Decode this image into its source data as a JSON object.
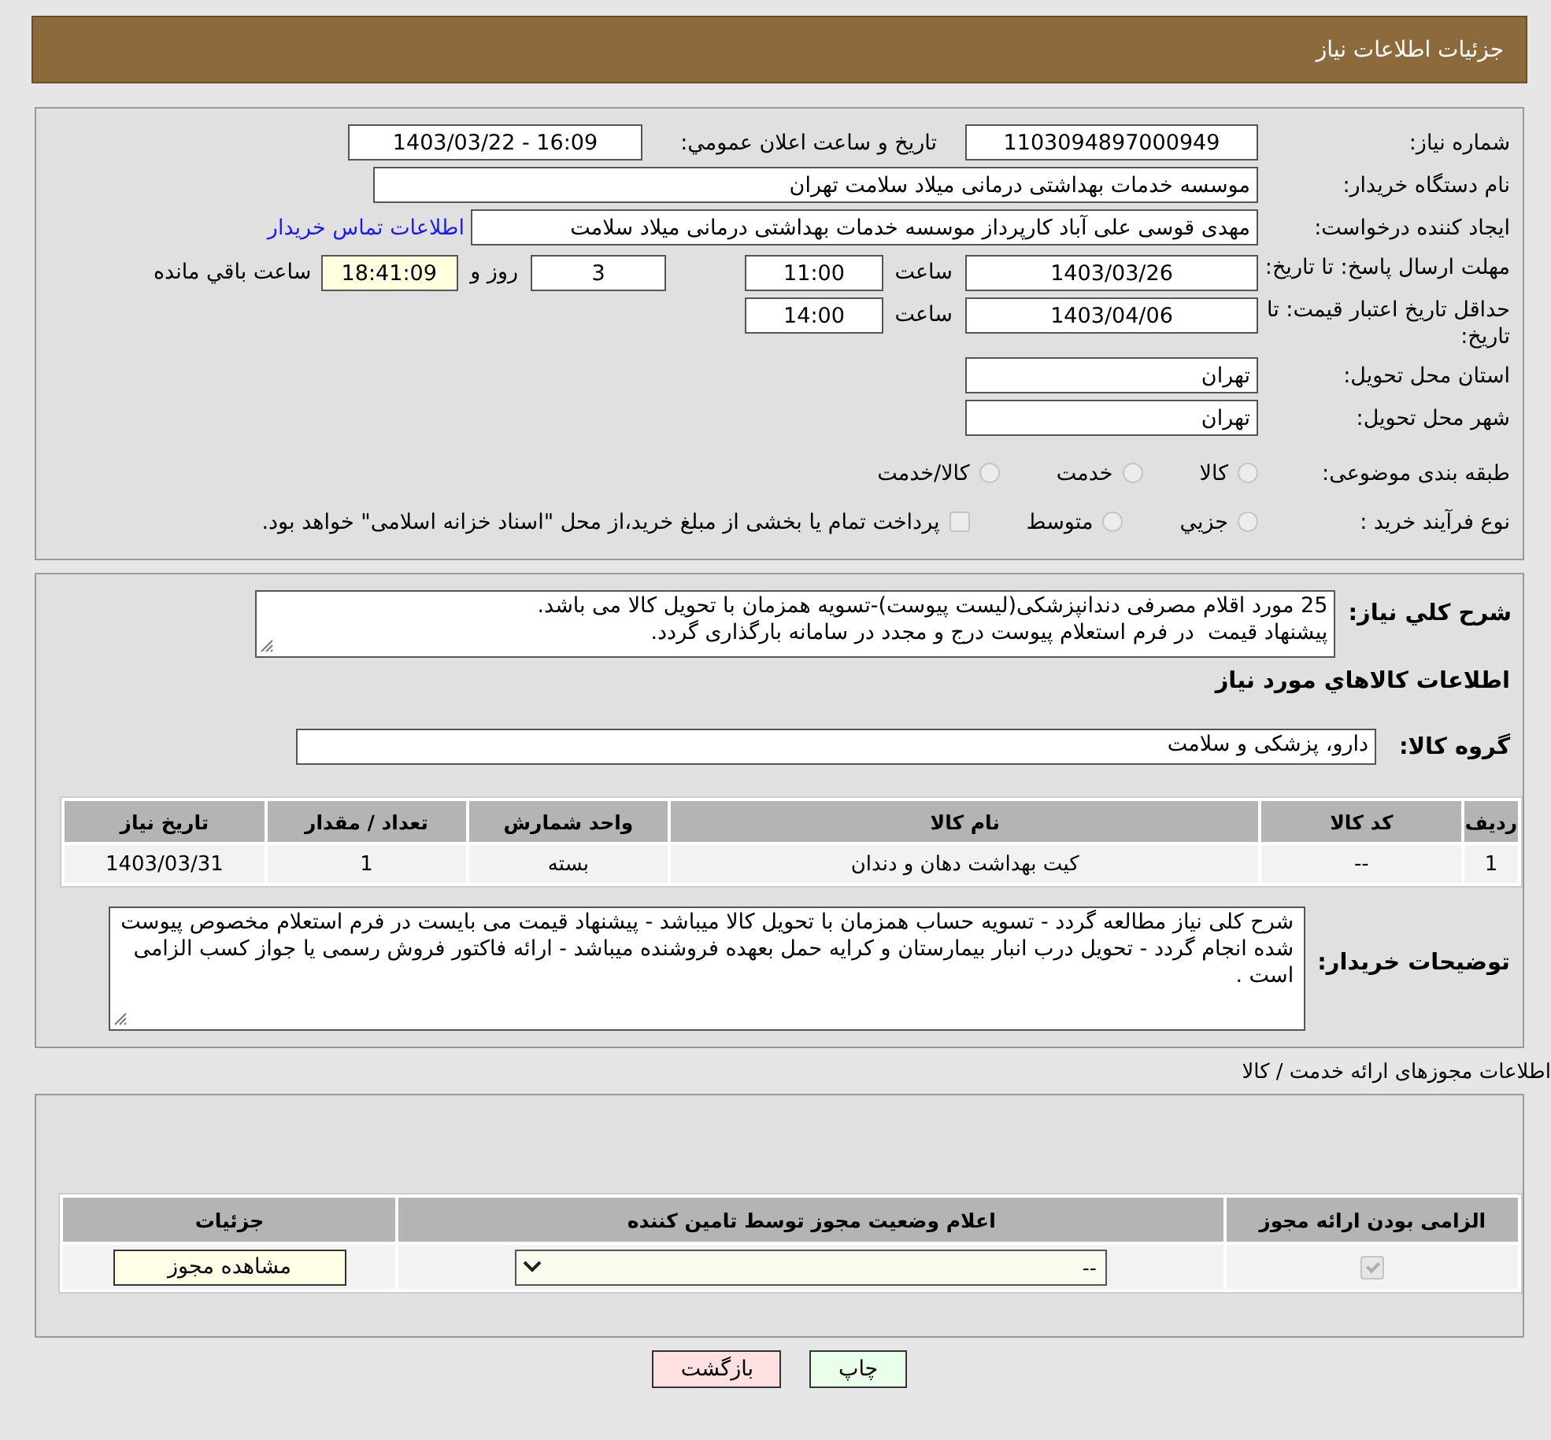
{
  "header": {
    "title": "جزئیات اطلاعات نیاز"
  },
  "info": {
    "need_number": {
      "label": "شماره نیاز:",
      "value": "1103094897000949"
    },
    "announce": {
      "label": "تاریخ و ساعت اعلان عمومي:",
      "value": "1403/03/22 - 16:09"
    },
    "buyer": {
      "label": "نام دستگاه خریدار:",
      "value": "موسسه خدمات بهداشتی درمانی میلاد سلامت تهران"
    },
    "requester": {
      "label": "ایجاد کننده درخواست:",
      "value": "مهدی قوسی علی آباد کارپرداز موسسه خدمات بهداشتی درمانی میلاد سلامت",
      "link": "اطلاعات تماس خریدار"
    },
    "reply_deadline": {
      "label": "مهلت ارسال پاسخ: تا تاریخ:",
      "date": "1403/03/26",
      "time_label": "ساعت",
      "time": "11:00",
      "days": "3",
      "days_label": "روز و",
      "remaining": "18:41:09",
      "remaining_label": "ساعت باقي مانده"
    },
    "price_validity": {
      "label": "حداقل تاریخ اعتبار قیمت: تا تاریخ:",
      "date": "1403/04/06",
      "time_label": "ساعت",
      "time": "14:00"
    },
    "province": {
      "label": "استان محل تحویل:",
      "value": "تهران"
    },
    "city": {
      "label": "شهر محل تحویل:",
      "value": "تهران"
    },
    "category": {
      "label": "طبقه بندی موضوعی:",
      "options": [
        {
          "label": "کالا",
          "kind": "radio",
          "selected": false
        },
        {
          "label": "خدمت",
          "kind": "radio",
          "selected": false
        },
        {
          "label": "کالا/خدمت",
          "kind": "radio",
          "selected": false
        }
      ]
    },
    "process": {
      "label": "نوع فرآیند خرید :",
      "options": [
        {
          "label": "جزيي",
          "kind": "radio",
          "selected": false
        },
        {
          "label": "متوسط",
          "kind": "radio",
          "selected": false
        },
        {
          "label": "پرداخت تمام یا بخشی از مبلغ خرید،از محل \"اسناد خزانه اسلامی\" خواهد بود.",
          "kind": "checkbox",
          "selected": false
        }
      ]
    }
  },
  "goods": {
    "description": {
      "label": "شرح کلي نياز:",
      "value": "25 مورد اقلام مصرفی دندانپزشکی(لیست پیوست)-تسویه همزمان با تحویل کالا می باشد.\nپیشنهاد قیمت  در فرم استعلام پیوست درج و مجدد در سامانه بارگذاری گردد."
    },
    "title": "اطلاعات کالاهاي مورد نياز",
    "group": {
      "label": "گروه کالا:",
      "value": "دارو، پزشکی و سلامت"
    },
    "table": {
      "columns": [
        "ردیف",
        "کد کالا",
        "نام کالا",
        "واحد شمارش",
        "تعداد / مقدار",
        "تاریخ نیاز"
      ],
      "rows": [
        [
          "1",
          "--",
          "کیت بهداشت دهان و دندان",
          "بسته",
          "1",
          "1403/03/31"
        ]
      ]
    },
    "notes": {
      "label": "توضیحات خریدار:",
      "value": "شرح کلی نیاز مطالعه گردد - تسویه حساب همزمان با تحویل کالا میباشد - پیشنهاد قیمت می بایست در فرم استعلام مخصوص پیوست شده انجام گردد - تحویل درب انبار بیمارستان و کرایه حمل بعهده فروشنده میباشد - ارائه فاکتور فروش رسمی یا جواز کسب الزامی است ."
    }
  },
  "licenses": {
    "title": "اطلاعات مجوزهای ارائه خدمت / کالا",
    "columns": [
      "الزامی بودن ارائه مجوز",
      "اعلام وضعیت مجوز توسط تامین کننده",
      "جزئیات"
    ],
    "rows": [
      {
        "required": true,
        "status": "--",
        "button": "مشاهده مجوز"
      }
    ]
  },
  "actions": [
    {
      "label": "چاپ",
      "kind": "print"
    },
    {
      "label": "بازگشت",
      "kind": "back"
    }
  ]
}
